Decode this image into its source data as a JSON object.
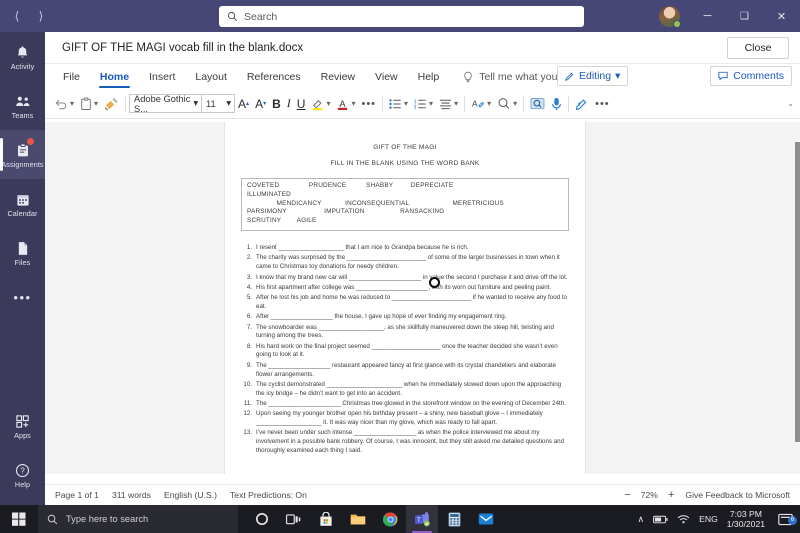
{
  "window": {
    "search_placeholder": "Search",
    "nav_back": "back-arrow",
    "nav_forward": "forward-arrow",
    "minimize": "─",
    "maximize": "❑",
    "close": "✕"
  },
  "rail": {
    "items": [
      {
        "label": "Activity",
        "icon": "bell-icon",
        "active": false,
        "badge": false
      },
      {
        "label": "Teams",
        "icon": "people-icon",
        "active": false,
        "badge": false
      },
      {
        "label": "Assignments",
        "icon": "clipboard-icon",
        "active": true,
        "badge": true
      },
      {
        "label": "Calendar",
        "icon": "calendar-icon",
        "active": false,
        "badge": false
      },
      {
        "label": "Files",
        "icon": "file-icon",
        "active": false,
        "badge": false
      }
    ],
    "more": "•••",
    "bottom": [
      {
        "label": "Apps",
        "icon": "apps-icon"
      },
      {
        "label": "Help",
        "icon": "help-icon"
      }
    ]
  },
  "doc_header": {
    "title": "GIFT OF THE MAGI vocab fill in the blank.docx",
    "close_label": "Close"
  },
  "ribbon_tabs": [
    {
      "label": "File",
      "active": false
    },
    {
      "label": "Home",
      "active": true
    },
    {
      "label": "Insert",
      "active": false
    },
    {
      "label": "Layout",
      "active": false
    },
    {
      "label": "References",
      "active": false
    },
    {
      "label": "Review",
      "active": false
    },
    {
      "label": "View",
      "active": false
    },
    {
      "label": "Help",
      "active": false
    }
  ],
  "tell_me": "Tell me what you want to do",
  "editing_label": "Editing",
  "comments_label": "Comments",
  "ribbon": {
    "font_name": "Adobe Gothic S...",
    "font_size": "11",
    "undo": "undo-icon",
    "paste": "paste-icon",
    "format_painter": "format-painter-icon",
    "grow_font": "A",
    "shrink_font": "A",
    "bold": "B",
    "italic": "I",
    "underline": "U",
    "highlight": "highlighter-icon",
    "font_color": "A",
    "more_font": "•••",
    "bullets": "bulleted-list-icon",
    "numbering": "numbered-list-icon",
    "align": "align-icon",
    "styles": "styles-icon",
    "find": "find-icon",
    "immersive_reader": "immersive-reader-icon",
    "dictate": "dictate-icon",
    "editor": "editor-icon",
    "more": "•••",
    "collapse": "⌄"
  },
  "document": {
    "heading1": "GIFT OF THE MAGI",
    "heading2": "FILL IN THE BLANK USING THE WORD BANK",
    "word_bank_rows": [
      "COVETED               PRUDENCE          SHABBY         DEPRECIATE",
      "ILLUMINATED",
      "               MENDICANCY            INCONSEQUENTIAL                      MERETRICIOUS",
      "PARSIMONY                   IMPUTATION                  RANSACKING",
      "SCRUTINY        AGILE"
    ],
    "questions": [
      {
        "num": "1.",
        "text": "I resent ___________________ that I am nice to Grandpa because he is rich."
      },
      {
        "num": "2.",
        "text": "The charity was surprised by the _______________________ of some of the larger businesses in town when it came to Christmas toy donations for needy children."
      },
      {
        "num": "3.",
        "text": "I know that my brand new car will _____________________ in value the second I purchase it and drive off the lot."
      },
      {
        "num": "4.",
        "text": "His first apartment after college was _____________________, with its worn out furniture and peeling paint."
      },
      {
        "num": "5.",
        "text": "After he lost his job and home he was reduced to _______________________ if he wanted to receive any food to eat."
      },
      {
        "num": "6.",
        "text": "After __________________ the house, I gave up hope of ever finding my engagement ring."
      },
      {
        "num": "7.",
        "text": "The snowboarder was ___________________, as she skillfully maneuvered down the steep hill, twisting and turning among the trees."
      },
      {
        "num": "8.",
        "text": "His hard work on the final project seemed ____________________ once the teacher decided she wasn’t even going to look at it."
      },
      {
        "num": "9.",
        "text": "The __________________ restaurant appeared fancy at first glance with its crystal chandeliers and elaborate flower arrangements."
      },
      {
        "num": "10.",
        "text": "The cyclist demonstrated ______________________ when he immediately slowed down upon the approaching the icy bridge – he didn’t want to get into an accident."
      },
      {
        "num": "11.",
        "text": "The  _____________________ Christmas tree glowed in the storefront window on the evening of December 24th."
      },
      {
        "num": "12.",
        "text": "Upon seeing my younger brother open his birthday present – a shiny, new baseball glove – I immediately ___________________ it.  It was way nicer than my glove, which was ready to fall apart."
      },
      {
        "num": "13.",
        "text": "I’ve never been under such intense __________________ as when the police interviewed me about my involvement in a possible bank robbery.  Of course, I was innocent, but they still asked me detailed questions and thoroughly examined each thing I said."
      }
    ]
  },
  "statusbar": {
    "page": "Page 1 of 1",
    "words": "311 words",
    "language": "English (U.S.)",
    "predictions": "Text Predictions: On",
    "zoom_out": "−",
    "zoom_level": "72%",
    "zoom_in": "+",
    "feedback": "Give Feedback to Microsoft"
  },
  "taskbar": {
    "start": "windows-icon",
    "search_placeholder": "Type here to search",
    "icons": [
      {
        "name": "cortana-icon"
      },
      {
        "name": "task-view-icon"
      },
      {
        "name": "microsoft-store-icon"
      },
      {
        "name": "file-explorer-icon"
      },
      {
        "name": "google-chrome-icon"
      },
      {
        "name": "microsoft-teams-icon"
      },
      {
        "name": "calculator-icon"
      },
      {
        "name": "mail-icon"
      }
    ],
    "tray": {
      "chevron": "∧",
      "battery": "battery-icon",
      "wifi": "wifi-icon",
      "language": "ENG",
      "time": "7:03 PM",
      "date": "1/30/2021",
      "notification_count": "6"
    }
  },
  "colors": {
    "teams_purple": "#464775",
    "word_blue": "#185abd",
    "badge_red": "#e8563f",
    "presence_green": "#92c353"
  }
}
